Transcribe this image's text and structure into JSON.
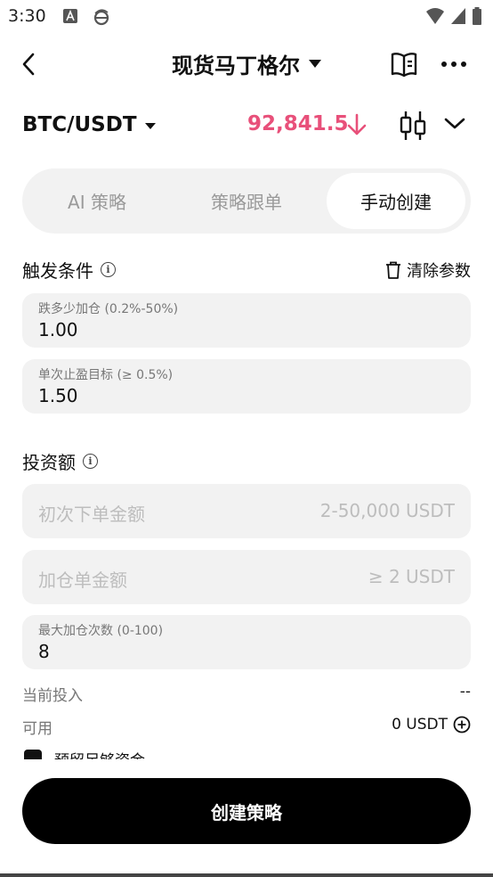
{
  "status_bar": {
    "time": "3:30"
  },
  "header": {
    "title": "现货马丁格尔"
  },
  "pair": {
    "name": "BTC/USDT",
    "price": "92,841.5"
  },
  "tabs": [
    {
      "label": "AI 策略",
      "active": false
    },
    {
      "label": "策略跟单",
      "active": false
    },
    {
      "label": "手动创建",
      "active": true
    }
  ],
  "trigger": {
    "title": "触发条件",
    "clear_label": "清除参数",
    "fields": [
      {
        "label": "跌多少加仓 (0.2%-50%)",
        "value": "1.00"
      },
      {
        "label": "单次止盈目标 (≥ 0.5%)",
        "value": "1.50"
      }
    ]
  },
  "investment": {
    "title": "投资额",
    "initial_order": {
      "placeholder": "初次下单金额",
      "hint": "2-50,000 USDT"
    },
    "add_order": {
      "placeholder": "加仓单金额",
      "hint": "≥ 2 USDT"
    },
    "max_adds": {
      "label": "最大加仓次数 (0-100)",
      "value": "8"
    },
    "current_label": "当前投入",
    "current_value": "--",
    "available_label": "可用",
    "available_value": "0 USDT",
    "reserve_label": "预留足够资金"
  },
  "cta": {
    "label": "创建策略"
  },
  "colors": {
    "price_down": "#e8507a",
    "accent": "#000000"
  }
}
